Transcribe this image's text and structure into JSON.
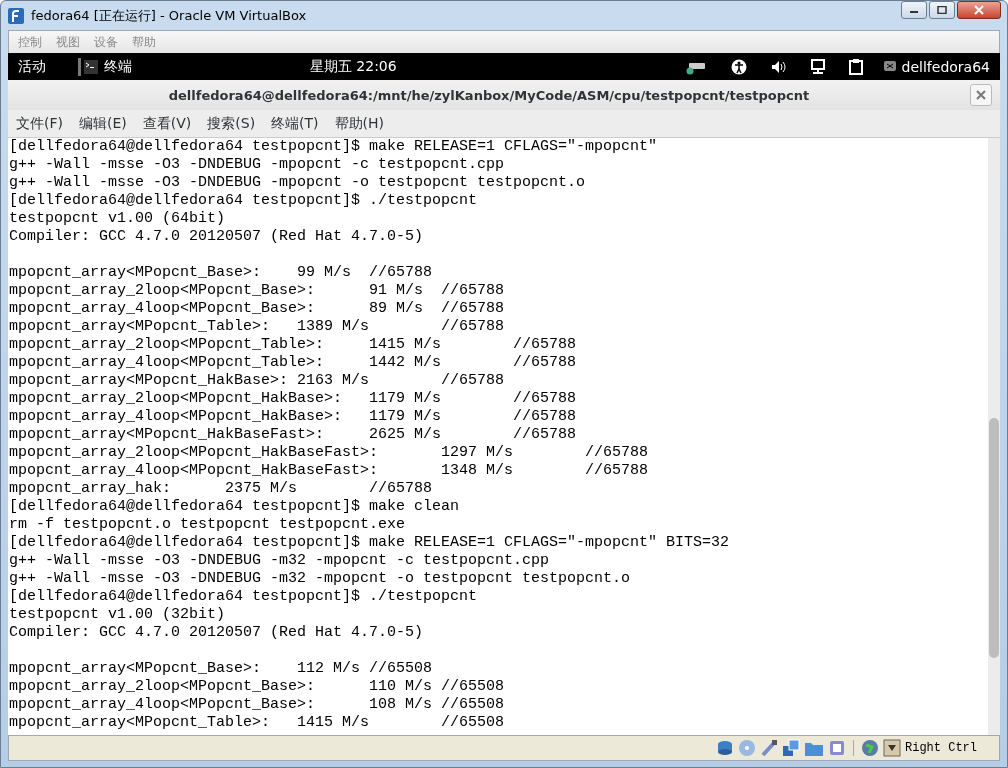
{
  "window": {
    "title": "fedora64 [正在运行] - Oracle VM VirtualBox"
  },
  "vbox_menu": [
    "控制",
    "视图",
    "设备",
    "帮助"
  ],
  "top_bar": {
    "activities": "活动",
    "app": "终端",
    "clock": "星期五  22:06",
    "user": "dellfedora64"
  },
  "terminal": {
    "title": "dellfedora64@dellfedora64:/mnt/he/zylKanbox/MyCode/ASM/cpu/testpopcnt/testpopcnt",
    "menu": [
      "文件(F)",
      "编辑(E)",
      "查看(V)",
      "搜索(S)",
      "终端(T)",
      "帮助(H)"
    ],
    "lines": [
      {
        "kind": "text",
        "text": "[dellfedora64@dellfedora64 testpopcnt]$ make RELEASE=1 CFLAGS=\"-mpopcnt\""
      },
      {
        "kind": "text",
        "text": "g++ -Wall -msse -O3 -DNDEBUG -mpopcnt -c testpopcnt.cpp"
      },
      {
        "kind": "text",
        "text": "g++ -Wall -msse -O3 -DNDEBUG -mpopcnt -o testpopcnt testpopcnt.o"
      },
      {
        "kind": "text",
        "text": "[dellfedora64@dellfedora64 testpopcnt]$ ./testpopcnt"
      },
      {
        "kind": "text",
        "text": "testpopcnt v1.00 (64bit)"
      },
      {
        "kind": "text",
        "text": "Compiler: GCC 4.7.0 20120507 (Red Hat 4.7.0-5)"
      },
      {
        "kind": "blank"
      },
      {
        "kind": "text",
        "text": "mpopcnt_array<MPopcnt_Base>:    99 M/s  //65788"
      },
      {
        "kind": "text",
        "text": "mpopcnt_array_2loop<MPopcnt_Base>:      91 M/s  //65788"
      },
      {
        "kind": "text",
        "text": "mpopcnt_array_4loop<MPopcnt_Base>:      89 M/s  //65788"
      },
      {
        "kind": "text",
        "text": "mpopcnt_array<MPopcnt_Table>:   1389 M/s        //65788"
      },
      {
        "kind": "text",
        "text": "mpopcnt_array_2loop<MPopcnt_Table>:     1415 M/s        //65788"
      },
      {
        "kind": "text",
        "text": "mpopcnt_array_4loop<MPopcnt_Table>:     1442 M/s        //65788"
      },
      {
        "kind": "text",
        "text": "mpopcnt_array<MPopcnt_HakBase>: 2163 M/s        //65788"
      },
      {
        "kind": "text",
        "text": "mpopcnt_array_2loop<MPopcnt_HakBase>:   1179 M/s        //65788"
      },
      {
        "kind": "text",
        "text": "mpopcnt_array_4loop<MPopcnt_HakBase>:   1179 M/s        //65788"
      },
      {
        "kind": "text",
        "text": "mpopcnt_array<MPopcnt_HakBaseFast>:     2625 M/s        //65788"
      },
      {
        "kind": "text",
        "text": "mpopcnt_array_2loop<MPopcnt_HakBaseFast>:       1297 M/s        //65788"
      },
      {
        "kind": "text",
        "text": "mpopcnt_array_4loop<MPopcnt_HakBaseFast>:       1348 M/s        //65788"
      },
      {
        "kind": "text",
        "text": "mpopcnt_array_hak:      2375 M/s        //65788"
      },
      {
        "kind": "text",
        "text": "[dellfedora64@dellfedora64 testpopcnt]$ make clean"
      },
      {
        "kind": "text",
        "text": "rm -f testpopcnt.o testpopcnt testpopcnt.exe"
      },
      {
        "kind": "text",
        "text": "[dellfedora64@dellfedora64 testpopcnt]$ make RELEASE=1 CFLAGS=\"-mpopcnt\" BITS=32"
      },
      {
        "kind": "text",
        "text": "g++ -Wall -msse -O3 -DNDEBUG -m32 -mpopcnt -c testpopcnt.cpp"
      },
      {
        "kind": "text",
        "text": "g++ -Wall -msse -O3 -DNDEBUG -m32 -mpopcnt -o testpopcnt testpopcnt.o"
      },
      {
        "kind": "text",
        "text": "[dellfedora64@dellfedora64 testpopcnt]$ ./testpopcnt"
      },
      {
        "kind": "text",
        "text": "testpopcnt v1.00 (32bit)"
      },
      {
        "kind": "text",
        "text": "Compiler: GCC 4.7.0 20120507 (Red Hat 4.7.0-5)"
      },
      {
        "kind": "blank"
      },
      {
        "kind": "text",
        "text": "mpopcnt_array<MPopcnt_Base>:    112 M/s //65508"
      },
      {
        "kind": "text",
        "text": "mpopcnt_array_2loop<MPopcnt_Base>:      110 M/s //65508"
      },
      {
        "kind": "text",
        "text": "mpopcnt_array_4loop<MPopcnt_Base>:      108 M/s //65508"
      },
      {
        "kind": "text",
        "text": "mpopcnt_array<MPopcnt_Table>:   1415 M/s        //65508"
      }
    ]
  },
  "status_bar": {
    "host_key": "Right Ctrl"
  }
}
